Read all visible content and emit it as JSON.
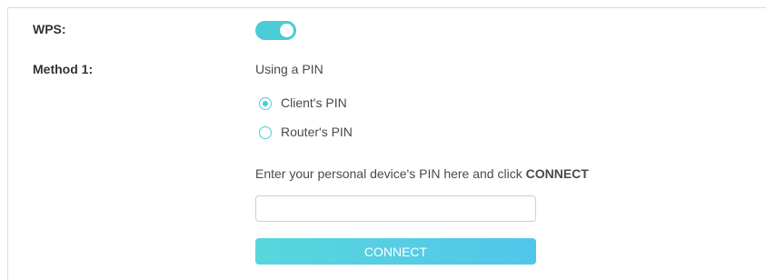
{
  "wps": {
    "label": "WPS:",
    "enabled": true
  },
  "method1": {
    "label": "Method 1:",
    "description": "Using a PIN",
    "options": [
      {
        "label": "Client's PIN",
        "selected": true
      },
      {
        "label": "Router's PIN",
        "selected": false
      }
    ],
    "instruction_prefix": "Enter your personal device's PIN here and click ",
    "instruction_bold": "CONNECT",
    "pin_value": "",
    "connect_label": "CONNECT"
  },
  "colors": {
    "accent": "#4acbd6",
    "button_gradient_start": "#58d6dc",
    "button_gradient_end": "#52c6ea"
  }
}
